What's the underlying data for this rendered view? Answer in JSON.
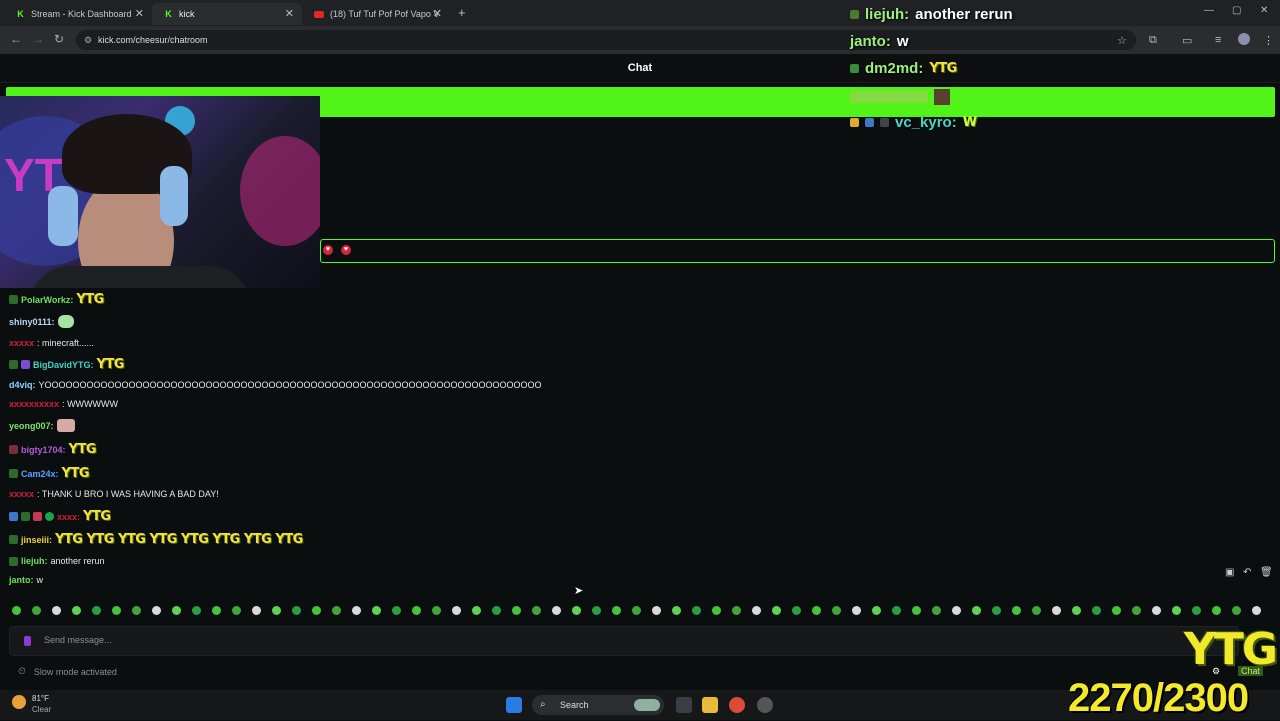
{
  "browser": {
    "tabs": [
      {
        "title": "Stream - Kick Dashboard",
        "favicon": "K"
      },
      {
        "title": "kick",
        "favicon": "K"
      },
      {
        "title": "(18) Tuf Tuf Pof Pof Vapo V",
        "favicon": "yt"
      }
    ],
    "url": "kick.com/cheesur/chatroom"
  },
  "chat_header": {
    "title": "Chat"
  },
  "overlay_chat": [
    {
      "user": "liejuh:",
      "text": "another rerun",
      "user_color": "#9ef07d"
    },
    {
      "user": "janto:",
      "text": "w",
      "user_color": "#9ef07d"
    },
    {
      "user": "dm2md:",
      "text": "YTG",
      "user_color": "#9ef07d"
    },
    {
      "user": "vc_kyro:",
      "text": "W",
      "user_color": "#43d9c9"
    }
  ],
  "chat_messages": [
    {
      "user": "PolarWorkz:",
      "text": "YTG",
      "user_color": "#6fe05c",
      "emote": true
    },
    {
      "user": "shiny0111:",
      "text": "",
      "user_color": "#b9d6f0",
      "emote": false
    },
    {
      "user": "xxxxx",
      "text": ": minecraft......",
      "user_color": "#d21d3a",
      "emote": false
    },
    {
      "user": "BigDavidYTG:",
      "text": "YTG",
      "user_color": "#45d3c8",
      "emote": true
    },
    {
      "user": "d4viq:",
      "text": "YOOOOOOOOOOOOOOOOOOOOOOOOOOOOOOOOOOOOOOOOOOOOOOOOOOOOOOOOOOOOOOOOOOOOOOO",
      "user_color": "#8ad4ff",
      "emote": false
    },
    {
      "user": "xxxxxxxxxx",
      "text": ": WWWWWW",
      "user_color": "#d21d3a",
      "emote": false
    },
    {
      "user": "yeong007:",
      "text": "",
      "user_color": "#7ee06b",
      "emote": false
    },
    {
      "user": "bigty1704:",
      "text": "YTG",
      "user_color": "#b25bd9",
      "emote": true
    },
    {
      "user": "Cam24x:",
      "text": "YTG",
      "user_color": "#5aa0ff",
      "emote": true
    },
    {
      "user": "xxxxx",
      "text": ": THANK U BRO I WAS HAVING A BAD DAY!",
      "user_color": "#d21d3a",
      "emote": false
    },
    {
      "user": "xxxx:",
      "text": "YTG",
      "user_color": "#d21d3a",
      "emote": true
    },
    {
      "user": "jinseiii:",
      "text": "YTG YTG YTG YTG YTG YTG YTG YTG",
      "user_color": "#f0d43a",
      "emote": true
    },
    {
      "user": "liejuh:",
      "text": "another rerun",
      "user_color": "#6fe05c",
      "emote": false
    },
    {
      "user": "janto:",
      "text": "w",
      "user_color": "#6fe05c",
      "emote": false
    }
  ],
  "composer": {
    "placeholder": "Send message...",
    "slow_mode": "Slow mode activated"
  },
  "weather": {
    "temp": "81°F",
    "condition": "Clear"
  },
  "taskbar": {
    "search": "Search"
  },
  "overlay": {
    "brand": "YTG",
    "counter": "2270/2300",
    "chat_label": "Chat"
  },
  "colors": {
    "kick_green": "#53fc18"
  }
}
